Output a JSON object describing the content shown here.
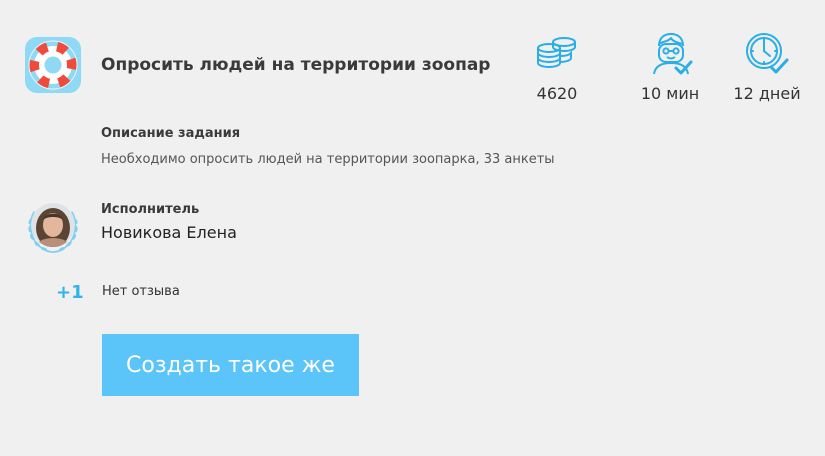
{
  "task": {
    "icon": "lifebuoy-icon",
    "title": "Опросить людей на территории зоопар"
  },
  "stats": {
    "coins": {
      "icon": "coins-icon",
      "value": "4620"
    },
    "time": {
      "icon": "person-check-icon",
      "value": "10 мин"
    },
    "days": {
      "icon": "clock-check-icon",
      "value": "12 дней"
    }
  },
  "description": {
    "heading": "Описание задания",
    "text": "Необходимо опросить людей на территории зоопарка, 33 анкеты"
  },
  "performer": {
    "heading": "Исполнитель",
    "name": "Новикова Елена",
    "avatar_icon": "avatar-laurel"
  },
  "rating": {
    "score": "+1",
    "review": "Нет отзыва"
  },
  "actions": {
    "create_label": "Создать такое же"
  },
  "colors": {
    "accent": "#5bc4f8",
    "score": "#2fb3ee",
    "icon_stroke": "#29aee6",
    "background": "#f0f0f0"
  }
}
